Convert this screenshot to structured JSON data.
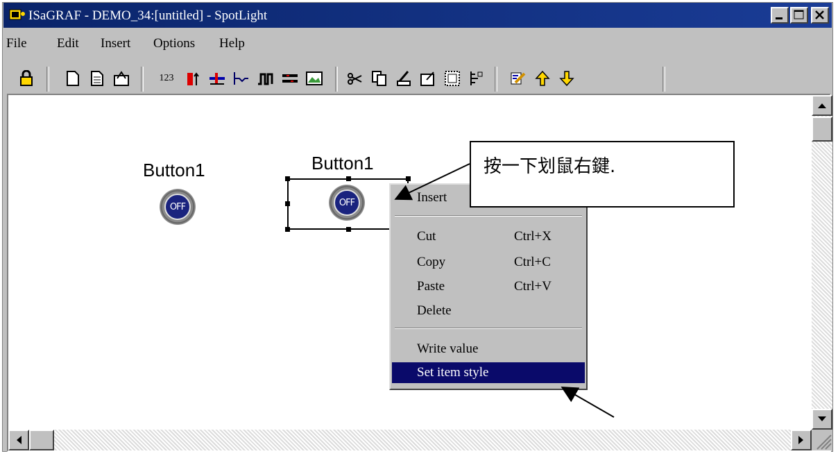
{
  "window": {
    "title": "ISaGRAF - DEMO_34:[untitled] - SpotLight",
    "controls": [
      "minimize",
      "maximize",
      "close"
    ]
  },
  "menu": [
    "File",
    "Edit",
    "Insert",
    "Options",
    "Help"
  ],
  "toolbar": {
    "text_button": "123",
    "icons": [
      "lock-icon",
      "new-icon",
      "open-icon",
      "save-icon",
      "numeric-icon",
      "bar-icon",
      "slider-icon",
      "trend-icon",
      "pulse-icon",
      "switch-icon",
      "image-icon",
      "cut-icon",
      "copy-icon",
      "paste-icon",
      "properties-icon",
      "grid-icon",
      "align-icon",
      "edit-icon",
      "up-arrow-icon",
      "down-arrow-icon"
    ]
  },
  "canvas": {
    "items": [
      {
        "label": "Button1",
        "state": "OFF"
      },
      {
        "label": "Button1",
        "state": "OFF"
      }
    ]
  },
  "context_menu": {
    "items": [
      {
        "label": "Insert",
        "shortcut": ""
      },
      {
        "label": "Cut",
        "shortcut": "Ctrl+X"
      },
      {
        "label": "Copy",
        "shortcut": "Ctrl+C"
      },
      {
        "label": "Paste",
        "shortcut": "Ctrl+V"
      },
      {
        "label": "Delete",
        "shortcut": ""
      },
      {
        "label": "Write value",
        "shortcut": ""
      },
      {
        "label": "Set item style",
        "shortcut": ""
      }
    ],
    "highlighted": "Set item style"
  },
  "callout": {
    "text": "按一下划鼠右鍵."
  },
  "colors": {
    "titlebar": "#0a246a",
    "highlight": "#0a0a6a",
    "button_face": "#c0c0c0"
  }
}
